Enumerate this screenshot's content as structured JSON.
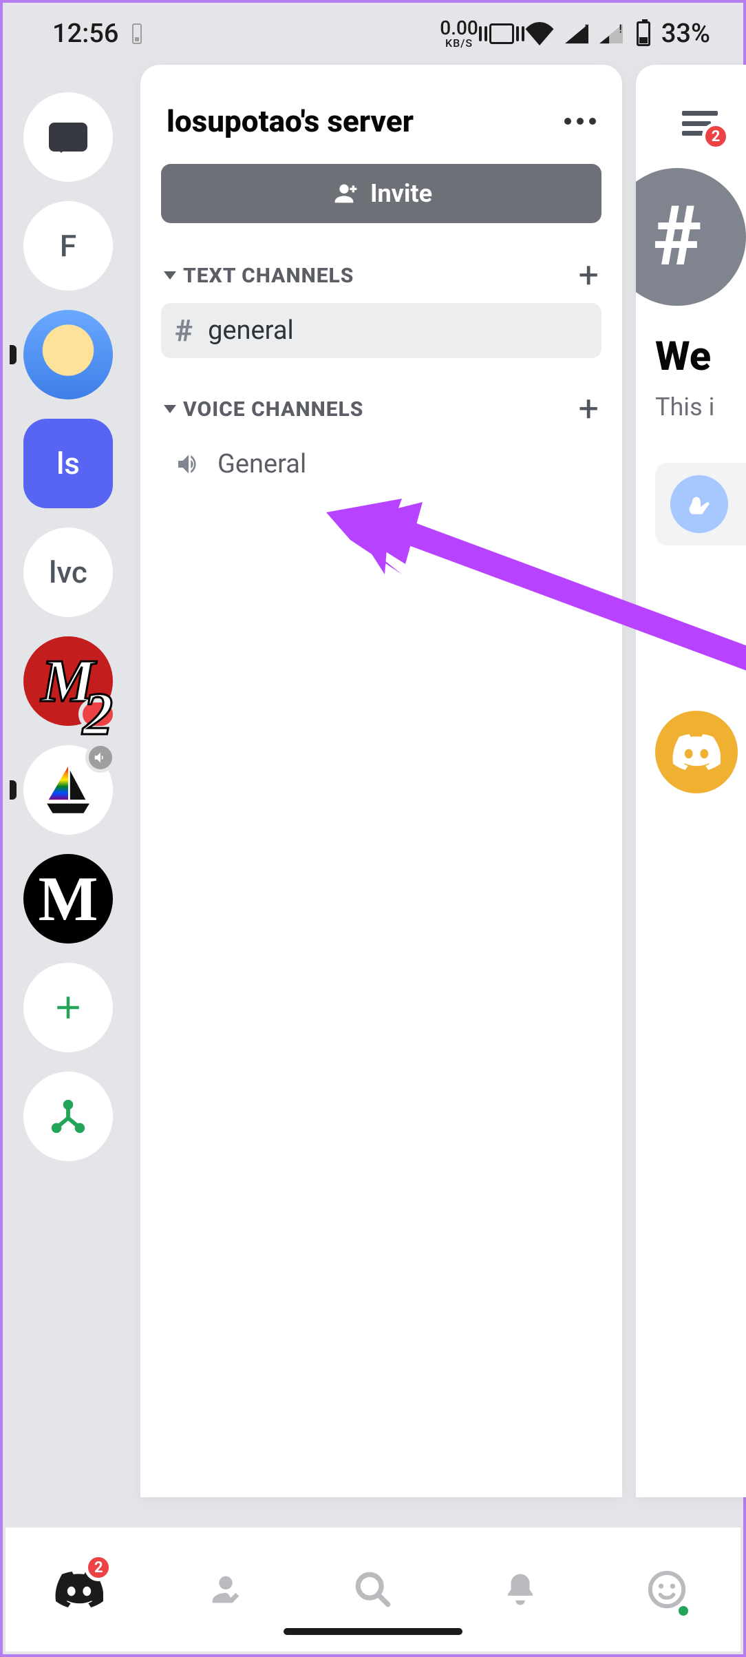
{
  "status": {
    "time": "12:56",
    "net_speed": "0.00",
    "net_unit": "KB/S",
    "battery_pct": "33%"
  },
  "server_rail": {
    "dm_label": "Direct Messages",
    "items": [
      {
        "id": "f",
        "label": "F",
        "type": "letter"
      },
      {
        "id": "cheese",
        "label": "",
        "type": "img",
        "indicator": true
      },
      {
        "id": "ls",
        "label": "ls",
        "type": "letter",
        "selected": true
      },
      {
        "id": "lvc",
        "label": "lvc",
        "type": "letter"
      },
      {
        "id": "m-red",
        "label": "M",
        "type": "img",
        "badge": "2"
      },
      {
        "id": "sail",
        "label": "",
        "type": "img",
        "muted": true,
        "indicator": true
      },
      {
        "id": "m-black",
        "label": "M",
        "type": "img"
      }
    ],
    "add_label": "Add a Server",
    "hub_label": "Student Hub"
  },
  "drawer": {
    "title": "losupotao's server",
    "invite_label": "Invite",
    "sections": [
      {
        "id": "text",
        "heading": "TEXT CHANNELS",
        "channels": [
          {
            "id": "general-text",
            "name": "general",
            "icon": "hash",
            "active": true
          }
        ]
      },
      {
        "id": "voice",
        "heading": "VOICE CHANNELS",
        "channels": [
          {
            "id": "general-voice",
            "name": "General",
            "icon": "speaker",
            "active": false
          }
        ]
      }
    ]
  },
  "peek": {
    "menu_badge": "2",
    "welcome_fragment": "We",
    "subtitle_fragment": "This i"
  },
  "bottom_nav": {
    "home_badge": "2",
    "items": [
      "home",
      "friends",
      "search",
      "notifications",
      "profile"
    ]
  }
}
